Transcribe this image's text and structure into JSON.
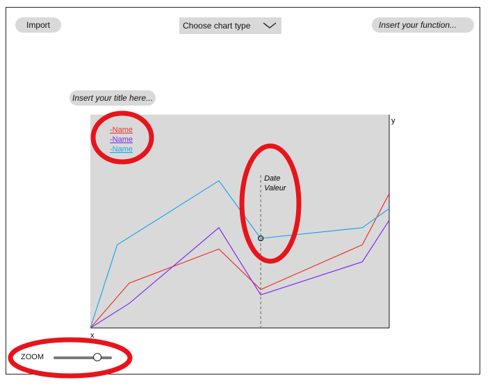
{
  "toolbar": {
    "import_label": "Import",
    "chart_type_label": "Choose chart type",
    "function_placeholder": "Insert your function..."
  },
  "title_placeholder": "Insert your title here...",
  "zoom": {
    "label": "ZOOM",
    "level": 0.75
  },
  "chart_data": {
    "type": "line",
    "xlabel": "x",
    "ylabel": "y",
    "legend": {
      "placement": "top-left"
    },
    "tooltip": {
      "line1": "Date",
      "line2": "Valeur"
    },
    "series": [
      {
        "name": "-Name",
        "color": "#e8352e",
        "points": [
          [
            0,
            0
          ],
          [
            0.13,
            0.21
          ],
          [
            0.43,
            0.37
          ],
          [
            0.57,
            0.18
          ],
          [
            0.91,
            0.39
          ],
          [
            1.0,
            0.63
          ]
        ]
      },
      {
        "name": "-Name",
        "color": "#7a2cf0",
        "points": [
          [
            0,
            0
          ],
          [
            0.13,
            0.115
          ],
          [
            0.43,
            0.47
          ],
          [
            0.57,
            0.155
          ],
          [
            0.91,
            0.31
          ],
          [
            1.0,
            0.505
          ]
        ]
      },
      {
        "name": "-Name",
        "color": "#1aa7e8",
        "points": [
          [
            0,
            0
          ],
          [
            0.09,
            0.39
          ],
          [
            0.43,
            0.69
          ],
          [
            0.57,
            0.42
          ],
          [
            0.91,
            0.47
          ],
          [
            1.0,
            0.56
          ]
        ]
      }
    ],
    "crosshair_x": 0.57,
    "highlight": {
      "series_index": 2,
      "x": 0.57
    }
  },
  "annotations": {
    "color": "#e8141b"
  }
}
